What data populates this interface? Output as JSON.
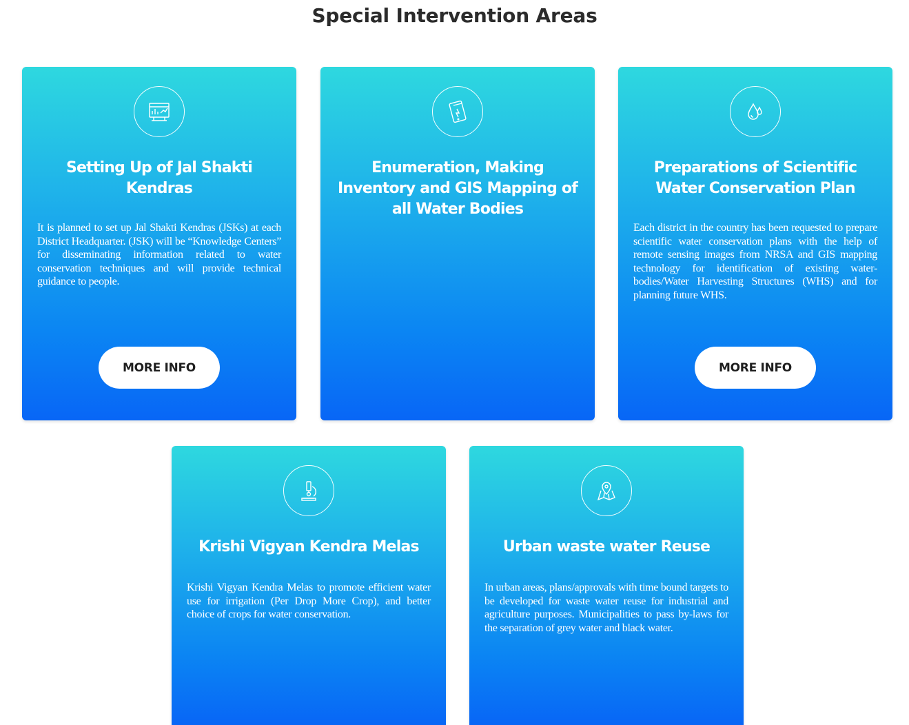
{
  "section": {
    "title": "Special Intervention Areas"
  },
  "cards": [
    {
      "icon": "dashboard-chart-icon",
      "title": "Setting Up of Jal Shakti Kendras",
      "description": "It is planned to set up Jal Shakti Kendras (JSKs) at each District Headquarter. (JSK) will be “Knowledge Centers” for disseminating information related to water conservation techniques and will provide technical guidance to people.",
      "button_label": "MORE INFO"
    },
    {
      "icon": "tablet-device-icon",
      "title": "Enumeration, Making Inventory and GIS Mapping of all Water Bodies",
      "description": "",
      "button_label": ""
    },
    {
      "icon": "water-drops-icon",
      "title": "Preparations of Scientific Water Conservation Plan",
      "description": "Each district in the country has been requested to prepare scientific water conservation plans with the help of remote sensing images from NRSA and GIS mapping technology for identification of existing water-bodies/Water Harvesting Structures (WHS) and for planning future WHS.",
      "button_label": "MORE INFO"
    },
    {
      "icon": "microscope-icon",
      "title": "Krishi Vigyan Kendra Melas",
      "description": "Krishi Vigyan Kendra Melas to promote efficient water use for irrigation (Per Drop More Crop), and better choice of crops for water conservation."
    },
    {
      "icon": "map-pin-icon",
      "title": "Urban waste water Reuse",
      "description": "In urban areas, plans/approvals with time bound targets to be developed for waste water reuse for industrial and agriculture purposes. Municipalities to pass by-laws for the separation of grey water and black water."
    }
  ]
}
